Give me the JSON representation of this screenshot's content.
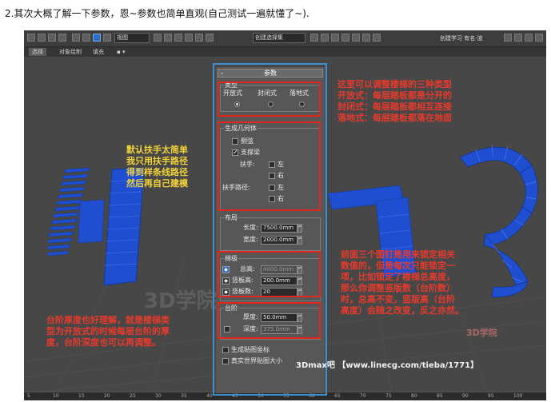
{
  "intro": "2.其次大概了解一下参数，恩~参数也简单直观(自己测试一遍就懂了~).",
  "toolbar": {
    "view_select": "视图",
    "named_select": "创建选择集",
    "right_text": "创建学习 有名·渲"
  },
  "tabs": [
    "选择",
    "对象绘制",
    "填充"
  ],
  "panel": {
    "title": "参数",
    "type_group": "类型",
    "type_options": [
      "开放式",
      "封闭式",
      "落地式"
    ],
    "geometry_group": "生成几何体",
    "side_string": "侧弦",
    "support_beam": "支撑梁",
    "handrail": "扶手:",
    "handrail_path": "扶手路径:",
    "left": "左",
    "right": "右",
    "layout_group": "布局",
    "length_label": "长度:",
    "length_value": "7500.0mm",
    "width_label": "宽度:",
    "width_value": "2000.0mm",
    "steps_group": "梯级",
    "total_height_label": "总高:",
    "total_height_value": "4000.0mm",
    "riser_height_label": "竖板高:",
    "riser_height_value": "200.0mm",
    "riser_count_label": "竖板数:",
    "riser_count_value": "20",
    "tread_group": "台阶",
    "thickness_label": "厚度:",
    "thickness_value": "50.0mm",
    "depth_label": "深度:",
    "depth_value": "375.0mm",
    "gen_mapping": "生成贴图坐标",
    "real_world_map": "真实世界贴图大小"
  },
  "notes": {
    "types": "这里可以调整楼梯的三种类型\n开放式：每层踏板都是分开的\n封闭式：每层踏板都相互连接\n落地式：每层踏板都落在地面",
    "handrail": "默认扶手太简单\n我只用扶手路径\n得到样条线路径\n然后再自己建模",
    "locks": "前面三个图钉是用来锁定相关\n数值的，但是每次只能锁定一\n项，比如锁定了楼梯总高度，\n那么你调整竖版数（台阶数）\n时，总高不变，竖版高（台阶\n高度）会随之改变，反之亦然。",
    "tread": "台阶厚度也好理解，就是楼梯类\n型为开放式的时候每层台阶的厚\n度，台阶深度也可以再调整。"
  },
  "ruler_ticks": [
    "5",
    "10",
    "15",
    "20",
    "25",
    "30",
    "35",
    "40",
    "45",
    "50",
    "55",
    "60",
    "65",
    "70",
    "75",
    "80",
    "85",
    "90",
    "95",
    "100"
  ],
  "watermark": "3Dmax吧 【www.linecg.com/tieba/1771】",
  "logo_text": "3D学院",
  "colors": {
    "stairs_blue": "#1f4fd0",
    "annotation_red": "#e0261f",
    "panel_frame_blue": "#3d8fd1"
  }
}
